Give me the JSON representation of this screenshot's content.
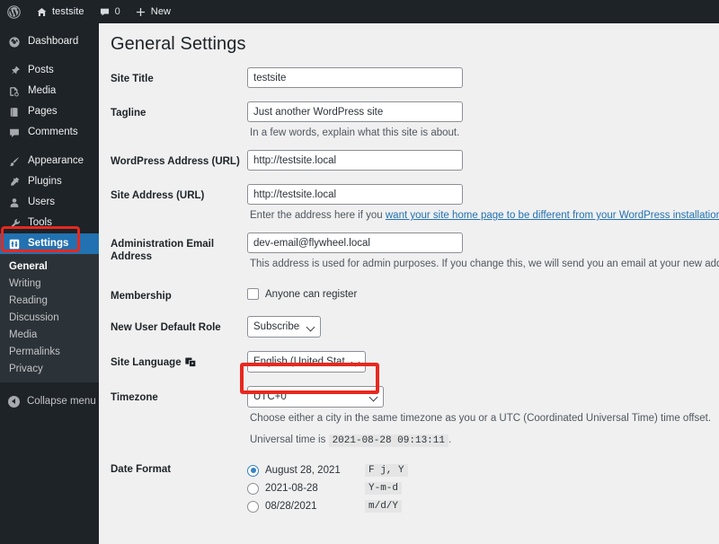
{
  "adminbar": {
    "items": [
      {
        "name": "wordpress-logo",
        "icon": "wordpress-logo-icon",
        "label": ""
      },
      {
        "name": "site-name",
        "icon": "home-icon",
        "label": "testsite"
      },
      {
        "name": "comments",
        "icon": "comment-icon",
        "label": "0"
      },
      {
        "name": "new-content",
        "icon": "plus-icon",
        "label": "New"
      }
    ]
  },
  "sidebar": {
    "items": [
      {
        "label": "Dashboard",
        "icon": "dashboard-icon",
        "name": "sidebar-item-dashboard",
        "current": false,
        "sep_after": true
      },
      {
        "label": "Posts",
        "icon": "pin-icon",
        "name": "sidebar-item-posts",
        "current": false,
        "sep_after": false
      },
      {
        "label": "Media",
        "icon": "media-icon",
        "name": "sidebar-item-media",
        "current": false,
        "sep_after": false
      },
      {
        "label": "Pages",
        "icon": "page-icon",
        "name": "sidebar-item-pages",
        "current": false,
        "sep_after": false
      },
      {
        "label": "Comments",
        "icon": "comment-icon",
        "name": "sidebar-item-comments",
        "current": false,
        "sep_after": true
      },
      {
        "label": "Appearance",
        "icon": "brush-icon",
        "name": "sidebar-item-appearance",
        "current": false,
        "sep_after": false
      },
      {
        "label": "Plugins",
        "icon": "plug-icon",
        "name": "sidebar-item-plugins",
        "current": false,
        "sep_after": false
      },
      {
        "label": "Users",
        "icon": "user-icon",
        "name": "sidebar-item-users",
        "current": false,
        "sep_after": false
      },
      {
        "label": "Tools",
        "icon": "wrench-icon",
        "name": "sidebar-item-tools",
        "current": false,
        "sep_after": false
      },
      {
        "label": "Settings",
        "icon": "gear-sliders-icon",
        "name": "sidebar-item-settings",
        "current": true,
        "sep_after": false
      }
    ],
    "submenu": [
      {
        "label": "General",
        "active": true
      },
      {
        "label": "Writing",
        "active": false
      },
      {
        "label": "Reading",
        "active": false
      },
      {
        "label": "Discussion",
        "active": false
      },
      {
        "label": "Media",
        "active": false
      },
      {
        "label": "Permalinks",
        "active": false
      },
      {
        "label": "Privacy",
        "active": false
      }
    ],
    "collapse_label": "Collapse menu"
  },
  "page": {
    "title": "General Settings"
  },
  "form": {
    "site_title": {
      "label": "Site Title",
      "value": "testsite"
    },
    "tagline": {
      "label": "Tagline",
      "value": "Just another WordPress site",
      "desc": "In a few words, explain what this site is about."
    },
    "wordpress_address": {
      "label": "WordPress Address (URL)",
      "value": "http://testsite.local"
    },
    "site_address": {
      "label": "Site Address (URL)",
      "value": "http://testsite.local",
      "desc_before": "Enter the address here if you ",
      "desc_link": "want your site home page to be different from your WordPress installation directory",
      "desc_after": "."
    },
    "admin_email": {
      "label": "Administration Email Address",
      "value": "dev-email@flywheel.local",
      "desc": "This address is used for admin purposes. If you change this, we will send you an email at your new address to confirm it"
    },
    "membership": {
      "label": "Membership",
      "checkbox_label": "Anyone can register",
      "checked": false
    },
    "new_user_role": {
      "label": "New User Default Role",
      "value": "Subscriber",
      "options": [
        "Subscriber"
      ]
    },
    "site_language": {
      "label": "Site Language",
      "icon": "translation-icon",
      "value": "English (United States)",
      "options": [
        "English (United States)"
      ],
      "highlighted": true
    },
    "timezone": {
      "label": "Timezone",
      "value": "UTC+0",
      "options": [
        "UTC+0"
      ],
      "desc": "Choose either a city in the same timezone as you or a UTC (Coordinated Universal Time) time offset.",
      "universal_prefix": "Universal time is",
      "universal_time": "2021-08-28 09:13:11",
      "universal_suffix": "."
    },
    "date_format": {
      "label": "Date Format",
      "options": [
        {
          "example": "August 28, 2021",
          "code": "F j, Y",
          "selected": true
        },
        {
          "example": "2021-08-28",
          "code": "Y-m-d",
          "selected": false
        },
        {
          "example": "08/28/2021",
          "code": "m/d/Y",
          "selected": false
        }
      ]
    }
  },
  "colors": {
    "admin_dark": "#1d2327",
    "submenu_bg": "#2c3338",
    "current_blue": "#2271b1",
    "highlight_red": "#e8281e",
    "content_bg": "#f0f0f1",
    "link_blue": "#2271b1"
  }
}
